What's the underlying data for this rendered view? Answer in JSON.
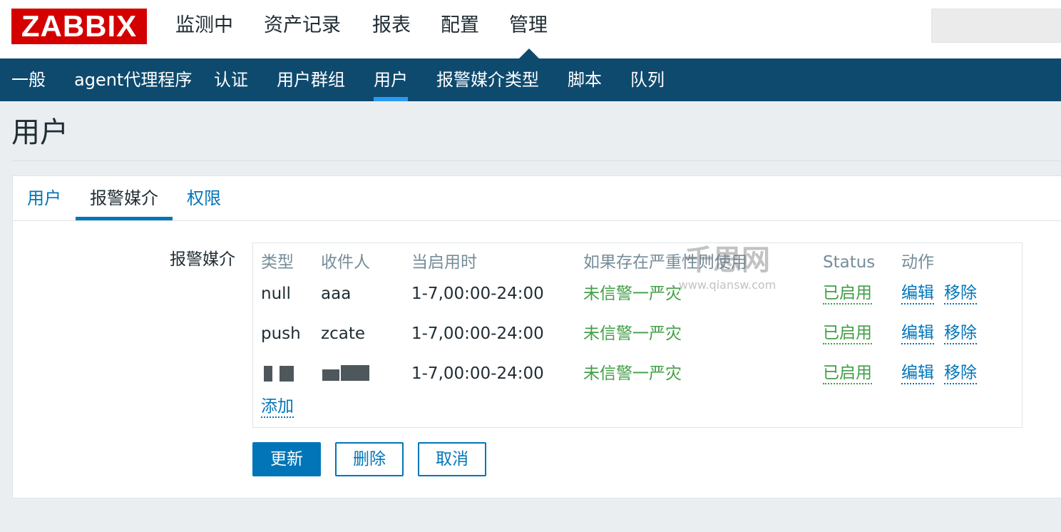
{
  "logo": "ZABBIX",
  "main_nav": [
    "监测中",
    "资产记录",
    "报表",
    "配置",
    "管理"
  ],
  "sub_nav": [
    "一般",
    "agent代理程序",
    "认证",
    "用户群组",
    "用户",
    "报警媒介类型",
    "脚本",
    "队列"
  ],
  "page_title": "用户",
  "tabs": [
    "用户",
    "报警媒介",
    "权限"
  ],
  "form_label": "报警媒介",
  "table": {
    "headers": [
      "类型",
      "收件人",
      "当启用时",
      "如果存在严重性则使用",
      "Status",
      "动作"
    ],
    "rows": [
      {
        "type": "null",
        "recipient": "aaa",
        "when": "1-7,00:00-24:00",
        "severity": "未信警一严灾",
        "status": "已启用",
        "edit": "编辑",
        "remove": "移除"
      },
      {
        "type": "push",
        "recipient": "zcate",
        "when": "1-7,00:00-24:00",
        "severity": "未信警一严灾",
        "status": "已启用",
        "edit": "编辑",
        "remove": "移除"
      },
      {
        "type": "",
        "recipient": "",
        "when": "1-7,00:00-24:00",
        "severity": "未信警一严灾",
        "status": "已启用",
        "edit": "编辑",
        "remove": "移除"
      }
    ],
    "add_link": "添加"
  },
  "buttons": {
    "update": "更新",
    "delete": "删除",
    "cancel": "取消"
  },
  "watermark": {
    "line1": "千思网",
    "line2": "www.qiansw.com"
  },
  "colors": {
    "brand": "#d40000",
    "subnav": "#0e4a6e",
    "link": "#0275b8",
    "enabled": "#429e47"
  }
}
